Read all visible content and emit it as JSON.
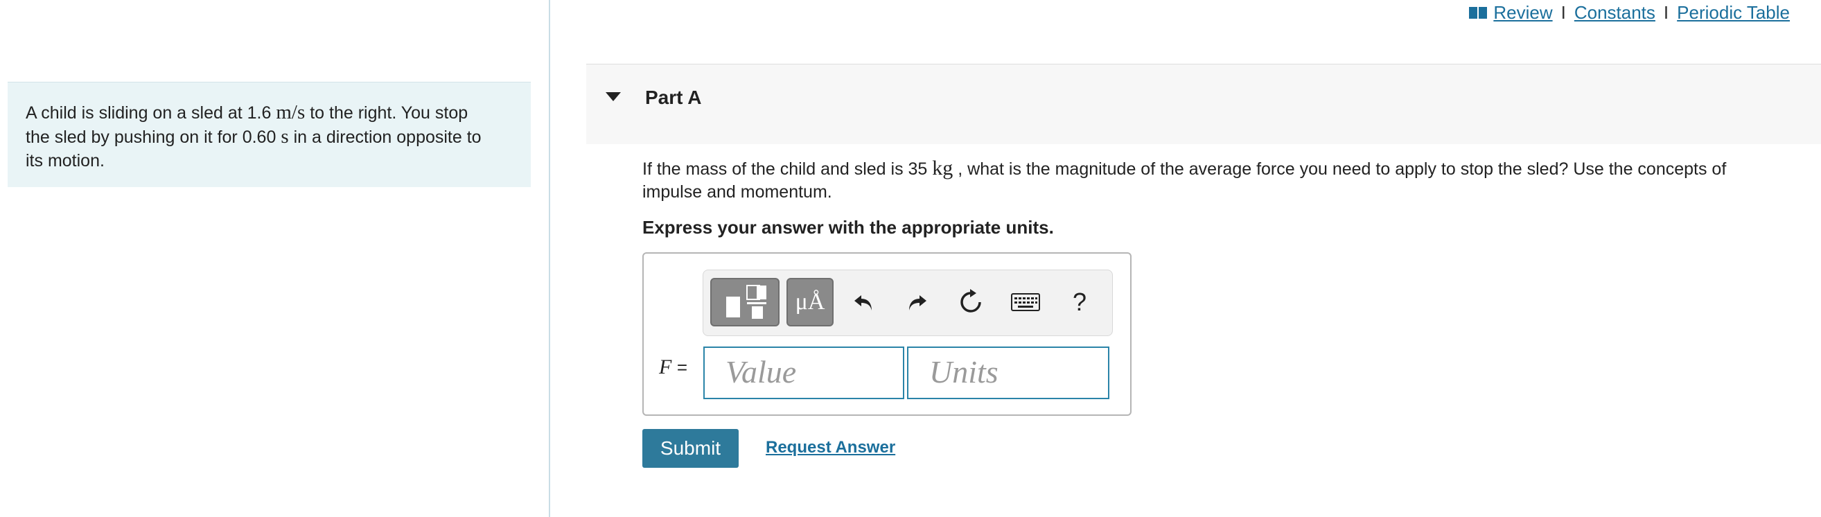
{
  "header": {
    "links": {
      "review": "Review",
      "separator": "I",
      "constants": "Constants",
      "periodic_table": "Periodic Table"
    },
    "icon": "book-icon"
  },
  "context": {
    "line1_pre": "A child is sliding on a sled at 1.6",
    "line1_unit": "m/s",
    "line1_post": "to the right. You stop",
    "line2": "the sled by pushing on it for 0.60",
    "line2_unit": "s",
    "line2_post": "in a direction opposite to",
    "line3": "its motion."
  },
  "part": {
    "title": "Part A",
    "toggle_icon": "caret-down-icon"
  },
  "question": {
    "pre": "If the mass of the child and sled is 35",
    "unit": "kg",
    "post": ", what is the magnitude of the average force you need to apply to stop the sled? Use the concepts of",
    "line2": "impulse and momentum."
  },
  "instruction": "Express your answer with the appropriate units.",
  "toolbar": {
    "templates_icon": "templates-icon",
    "units_label": "μÅ",
    "undo_icon": "undo-icon",
    "redo_icon": "redo-icon",
    "reset_icon": "reset-icon",
    "keyboard_icon": "keyboard-icon",
    "help_label": "?"
  },
  "answer": {
    "variable": "F",
    "equals": "=",
    "value_placeholder": "Value",
    "units_placeholder": "Units"
  },
  "actions": {
    "submit_label": "Submit",
    "request_label": "Request Answer"
  },
  "colors": {
    "accent": "#2e7a9b",
    "link": "#1b6f9c",
    "context_bg": "#e9f4f6",
    "field_border": "#2a84a8"
  }
}
